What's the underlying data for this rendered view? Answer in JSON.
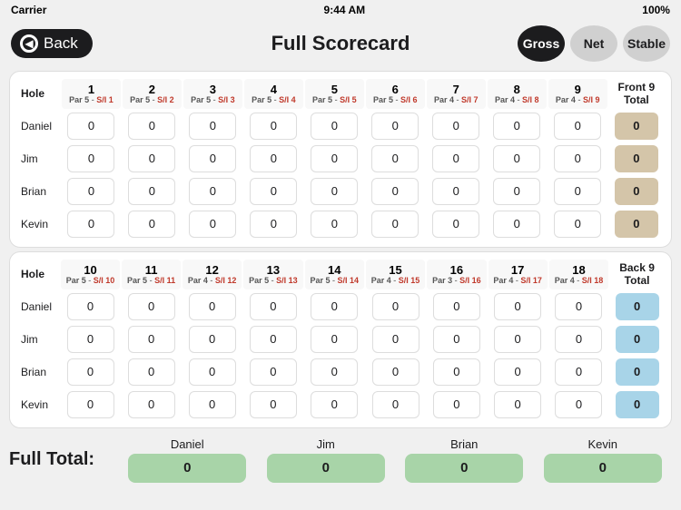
{
  "statusBar": {
    "carrier": "Carrier",
    "wifi": "wifi",
    "time": "9:44 AM",
    "battery": "100%"
  },
  "header": {
    "backLabel": "Back",
    "title": "Full Scorecard",
    "buttons": {
      "gross": "Gross",
      "net": "Net",
      "stable": "Stable"
    }
  },
  "front9": {
    "sectionLabel": "Hole",
    "totalLabel": "Front 9",
    "totalSub": "Total",
    "holes": [
      {
        "num": "1",
        "par": "5",
        "si": "1"
      },
      {
        "num": "2",
        "par": "5",
        "si": "2"
      },
      {
        "num": "3",
        "par": "5",
        "si": "3"
      },
      {
        "num": "4",
        "par": "5",
        "si": "4"
      },
      {
        "num": "5",
        "par": "5",
        "si": "5"
      },
      {
        "num": "6",
        "par": "5",
        "si": "6"
      },
      {
        "num": "7",
        "par": "4",
        "si": "7"
      },
      {
        "num": "8",
        "par": "4",
        "si": "8"
      },
      {
        "num": "9",
        "par": "4",
        "si": "9"
      }
    ],
    "players": [
      {
        "name": "Daniel",
        "scores": [
          0,
          0,
          0,
          0,
          0,
          0,
          0,
          0,
          0
        ],
        "total": 0
      },
      {
        "name": "Jim",
        "scores": [
          0,
          0,
          0,
          0,
          0,
          0,
          0,
          0,
          0
        ],
        "total": 0
      },
      {
        "name": "Brian",
        "scores": [
          0,
          0,
          0,
          0,
          0,
          0,
          0,
          0,
          0
        ],
        "total": 0
      },
      {
        "name": "Kevin",
        "scores": [
          0,
          0,
          0,
          0,
          0,
          0,
          0,
          0,
          0
        ],
        "total": 0
      }
    ]
  },
  "back9": {
    "sectionLabel": "Hole",
    "totalLabel": "Back 9",
    "totalSub": "Total",
    "holes": [
      {
        "num": "10",
        "par": "5",
        "si": "10"
      },
      {
        "num": "11",
        "par": "5",
        "si": "11"
      },
      {
        "num": "12",
        "par": "4",
        "si": "12"
      },
      {
        "num": "13",
        "par": "5",
        "si": "13"
      },
      {
        "num": "14",
        "par": "5",
        "si": "14"
      },
      {
        "num": "15",
        "par": "4",
        "si": "15"
      },
      {
        "num": "16",
        "par": "3",
        "si": "16"
      },
      {
        "num": "17",
        "par": "4",
        "si": "17"
      },
      {
        "num": "18",
        "par": "4",
        "si": "18"
      }
    ],
    "players": [
      {
        "name": "Daniel",
        "scores": [
          0,
          0,
          0,
          0,
          0,
          0,
          0,
          0,
          0
        ],
        "total": 0
      },
      {
        "name": "Jim",
        "scores": [
          0,
          0,
          0,
          0,
          0,
          0,
          0,
          0,
          0
        ],
        "total": 0
      },
      {
        "name": "Brian",
        "scores": [
          0,
          0,
          0,
          0,
          0,
          0,
          0,
          0,
          0
        ],
        "total": 0
      },
      {
        "name": "Kevin",
        "scores": [
          0,
          0,
          0,
          0,
          0,
          0,
          0,
          0,
          0
        ],
        "total": 0
      }
    ]
  },
  "fullTotal": {
    "label": "Full Total:",
    "players": [
      {
        "name": "Daniel",
        "total": 0
      },
      {
        "name": "Jim",
        "total": 0
      },
      {
        "name": "Brian",
        "total": 0
      },
      {
        "name": "Kevin",
        "total": 0
      }
    ]
  }
}
